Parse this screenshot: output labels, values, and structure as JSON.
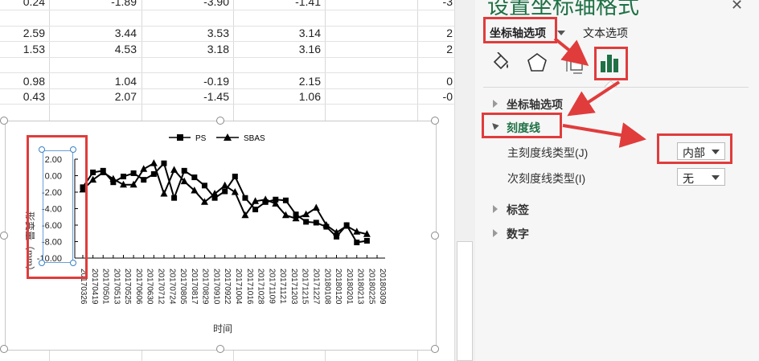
{
  "sheet": {
    "rows": [
      {
        "cells": [
          "0.24",
          "-1.89",
          "-3.90",
          "-1.41",
          "-3"
        ]
      },
      {
        "cells": [
          "",
          "",
          "",
          "",
          ""
        ]
      },
      {
        "cells": [
          "2.59",
          "3.44",
          "3.53",
          "3.14",
          "2"
        ]
      },
      {
        "cells": [
          "1.53",
          "4.53",
          "3.18",
          "3.16",
          "2"
        ]
      },
      {
        "cells": [
          "",
          "",
          "",
          "",
          ""
        ]
      },
      {
        "cells": [
          "0.98",
          "1.04",
          "-0.19",
          "2.15",
          "0"
        ]
      },
      {
        "cells": [
          "0.43",
          "2.07",
          "-1.45",
          "1.06",
          "-0"
        ]
      }
    ]
  },
  "chart_data": {
    "type": "line",
    "x": [
      "20170326",
      "20170407",
      "20170419",
      "20170501",
      "20170513",
      "20170525",
      "20170606",
      "20170618",
      "20170630",
      "20170712",
      "20170724",
      "20170805",
      "20170817",
      "20170829",
      "20170910",
      "20170922",
      "20171004",
      "20171016",
      "20171028",
      "20171109",
      "20171121",
      "20171203",
      "20171215",
      "20171227",
      "20180108",
      "20180120",
      "20180201",
      "20180213",
      "20180225",
      "20180309"
    ],
    "x_tick_labels": [
      "20170326",
      "20170419",
      "20170501",
      "20170513",
      "20170525",
      "20170606",
      "20170630",
      "20170712",
      "20170724",
      "20170805",
      "20170817",
      "20170829",
      "20170910",
      "20170922",
      "20171004",
      "20171016",
      "20171028",
      "20171109",
      "20171121",
      "20171203",
      "20171215",
      "20171227",
      "20180108",
      "20180120",
      "20180201",
      "20180213",
      "20180225",
      "20180309"
    ],
    "series": [
      {
        "name": "PS",
        "marker": "square",
        "values": [
          -1.4,
          0.4,
          0.6,
          -0.8,
          -0.1,
          0.3,
          -0.5,
          0.2,
          1.5,
          -2.7,
          0.6,
          -0.2,
          -1.2,
          -2.7,
          -1.9,
          -0.1,
          -2.7,
          -4.1,
          -3.2,
          -2.9,
          -3.0,
          -4.7,
          -5.6,
          -5.7,
          -6.2,
          -7.4,
          -6.0,
          -8.1,
          -7.9
        ]
      },
      {
        "name": "SBAS",
        "marker": "triangle",
        "values": [
          -1.7,
          -0.5,
          0.4,
          -0.4,
          -1.1,
          -1.1,
          0.8,
          1.5,
          -2.2,
          0.7,
          -0.7,
          -1.8,
          -3.2,
          -2.2,
          -1.2,
          -2.0,
          -4.8,
          -3.1,
          -2.9,
          -3.4,
          -4.8,
          -5.2,
          -4.7,
          -3.9,
          -6.0,
          -6.9,
          -6.1,
          -6.8,
          -7.1
        ]
      }
    ],
    "yticks": [
      "2.00",
      "0.00",
      "-2.00",
      "-4.00",
      "-6.00",
      "-8.00",
      "-10.00"
    ],
    "ylim": [
      -10,
      2
    ],
    "xlabel": "时间",
    "ylabel": "形变量（mm）",
    "legend": "top",
    "grid": false
  },
  "pane": {
    "title": "设置坐标轴格式",
    "tab_axis_options": "坐标轴选项",
    "tab_text_options": "文本选项",
    "sections": {
      "axis_options": "坐标轴选项",
      "tick_marks": "刻度线",
      "labels": "标签",
      "number": "数字"
    },
    "major_tick_label": "主刻度线类型(J)",
    "major_tick_value": "内部",
    "minor_tick_label": "次刻度线类型(I)",
    "minor_tick_value": "无",
    "accent_color": "#1e7145",
    "highlight_color": "#e03c3c"
  }
}
